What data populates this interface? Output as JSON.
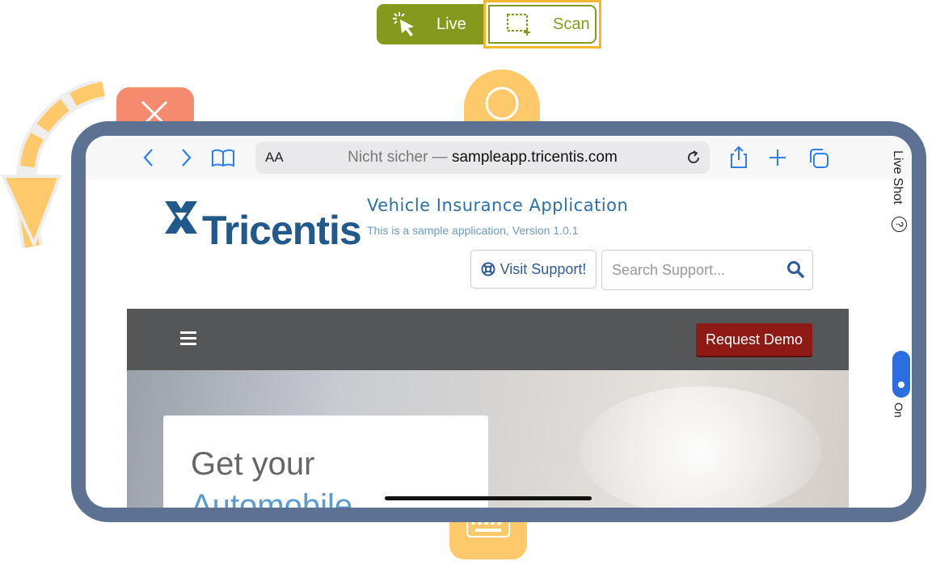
{
  "mode_toggle": {
    "live_label": "Live",
    "scan_label": "Scan",
    "active": "Scan"
  },
  "browser": {
    "text_size_label": "AA",
    "url_prefix": "Nicht sicher — ",
    "url_host": "sampleapp.tricentis.com"
  },
  "page": {
    "brand": "Tricentis",
    "title": "Vehicle Insurance Application",
    "subtitle": "This is a sample application, Version 1.0.1",
    "support_button": "Visit Support!",
    "search_placeholder": "Search Support...",
    "request_demo": "Request Demo",
    "hero_line1": "Get your",
    "hero_line2": "Automobile"
  },
  "side": {
    "live_shot_label": "Live Shot",
    "toggle_label": "On",
    "toggle_state": "on"
  },
  "colors": {
    "accent_green": "#859a1d",
    "highlight_yellow": "#f2b632",
    "device_frame": "#5d7292",
    "brand_blue": "#21598c",
    "demo_red": "#8d1a14",
    "toggle_blue": "#2b6ee0"
  }
}
